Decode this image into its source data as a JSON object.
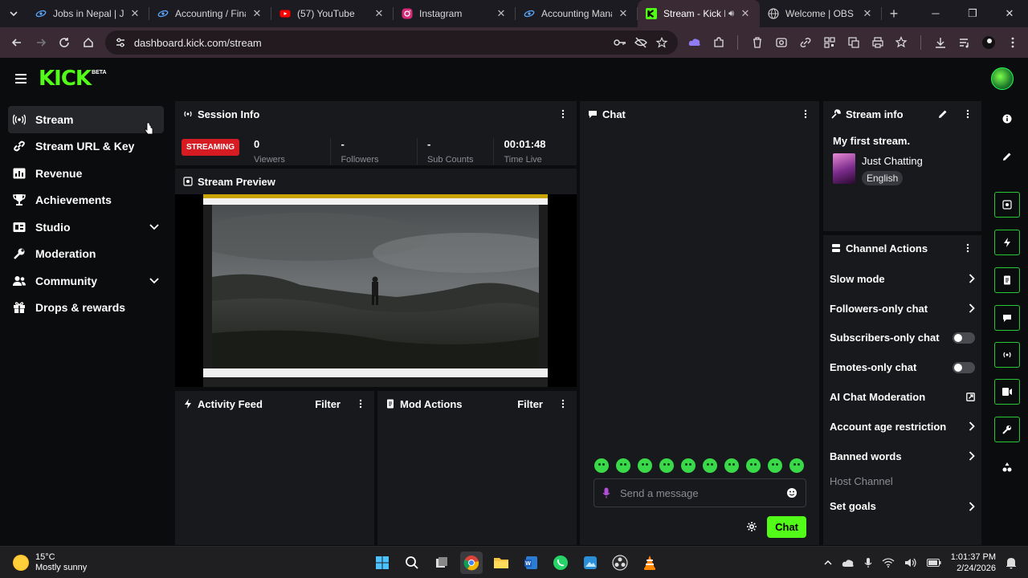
{
  "browser": {
    "tabs": [
      {
        "title": "Jobs in Nepal | Job V",
        "icon": "orbit-icon",
        "active": false
      },
      {
        "title": "Accounting / Finance",
        "icon": "orbit-icon",
        "active": false
      },
      {
        "title": "(57) YouTube",
        "icon": "youtube-icon",
        "active": false
      },
      {
        "title": "Instagram",
        "icon": "instagram-icon",
        "active": false
      },
      {
        "title": "Accounting Manage",
        "icon": "orbit-icon",
        "active": false
      },
      {
        "title": "Stream - Kick Das",
        "icon": "kick-icon",
        "active": true
      },
      {
        "title": "Welcome | OBS",
        "icon": "globe-icon",
        "active": false
      }
    ],
    "new_tab": "+",
    "url": "dashboard.kick.com/stream"
  },
  "kick": {
    "logo": "KICK",
    "beta": "BETA"
  },
  "sidebar": {
    "items": [
      {
        "label": "Stream",
        "icon": "stream-icon",
        "active": true,
        "expandable": false
      },
      {
        "label": "Stream URL & Key",
        "icon": "link-icon",
        "active": false,
        "expandable": false
      },
      {
        "label": "Revenue",
        "icon": "chart-icon",
        "active": false,
        "expandable": false
      },
      {
        "label": "Achievements",
        "icon": "trophy-icon",
        "active": false,
        "expandable": false
      },
      {
        "label": "Studio",
        "icon": "studio-icon",
        "active": false,
        "expandable": true
      },
      {
        "label": "Moderation",
        "icon": "wrench-icon",
        "active": false,
        "expandable": false
      },
      {
        "label": "Community",
        "icon": "users-icon",
        "active": false,
        "expandable": true
      },
      {
        "label": "Drops & rewards",
        "icon": "gift-icon",
        "active": false,
        "expandable": false
      }
    ]
  },
  "session": {
    "title": "Session Info",
    "badge": "STREAMING",
    "stats": [
      {
        "value": "0",
        "label": "Viewers"
      },
      {
        "value": "-",
        "label": "Followers"
      },
      {
        "value": "-",
        "label": "Sub Counts"
      }
    ],
    "time_value": "00:01:48",
    "time_label": "Time Live"
  },
  "preview": {
    "title": "Stream Preview"
  },
  "activity": {
    "title": "Activity Feed",
    "filter": "Filter"
  },
  "mod_actions": {
    "title": "Mod Actions",
    "filter": "Filter"
  },
  "chat": {
    "title": "Chat",
    "placeholder": "Send a message",
    "send": "Chat",
    "emote_count": 10
  },
  "stream_info": {
    "title": "Stream info",
    "stream_title": "My first stream.",
    "category": "Just Chatting",
    "language": "English"
  },
  "channel_actions": {
    "title": "Channel Actions",
    "rows": [
      {
        "label": "Slow mode",
        "control": "chevron"
      },
      {
        "label": "Followers-only chat",
        "control": "chevron"
      },
      {
        "label": "Subscribers-only chat",
        "control": "toggle"
      },
      {
        "label": "Emotes-only chat",
        "control": "toggle"
      },
      {
        "label": "AI Chat Moderation",
        "control": "external"
      },
      {
        "label": "Account age restriction",
        "control": "chevron"
      },
      {
        "label": "Banned words",
        "control": "chevron"
      }
    ],
    "host_channel": "Host Channel",
    "set_goals": "Set goals"
  },
  "taskbar": {
    "temperature": "15°C",
    "weather": "Mostly sunny",
    "time": "1:01:37 PM",
    "date": "2/24/2026"
  },
  "colors": {
    "accent": "#53fc18",
    "live": "#d61b23"
  }
}
